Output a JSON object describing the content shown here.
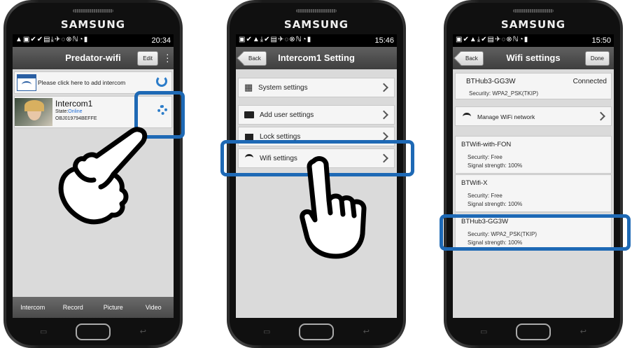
{
  "brand": "SAMSUNG",
  "accent_color": "#1e69b5",
  "phone1": {
    "time": "20:34",
    "title": "Predator-wifi",
    "edit_label": "Edit",
    "add_intercom_label": "Please click here to add intercom",
    "intercom": {
      "name": "Intercom1",
      "state_label": "State:",
      "state_value": "Online",
      "id": "OBJ019794BEFFE"
    },
    "tabs": [
      "Intercom",
      "Record",
      "Picture",
      "Video"
    ]
  },
  "phone2": {
    "time": "15:46",
    "back_label": "Back",
    "title": "Intercom1  Setting",
    "items": [
      "System settings",
      "Add user settings",
      "Lock settings",
      "Wifi settings"
    ]
  },
  "phone3": {
    "time": "15:50",
    "back_label": "Back",
    "title": "Wifi settings",
    "done_label": "Done",
    "current": {
      "ssid": "BTHub3-GG3W",
      "status": "Connected",
      "security": "Security:  WPA2_PSK(TKIP)"
    },
    "manage_label": "Manage WiFi network",
    "networks": [
      {
        "ssid": "BTWifi-with-FON",
        "security": "Security:  Free",
        "signal": "Signal strength:  100%"
      },
      {
        "ssid": "BTWifi-X",
        "security": "Security:  Free",
        "signal": "Signal strength:  100%"
      },
      {
        "ssid": "BTHub3-GG3W",
        "security": "Security:  WPA2_PSK(TKIP)",
        "signal": "Signal strength:  100%"
      }
    ]
  }
}
